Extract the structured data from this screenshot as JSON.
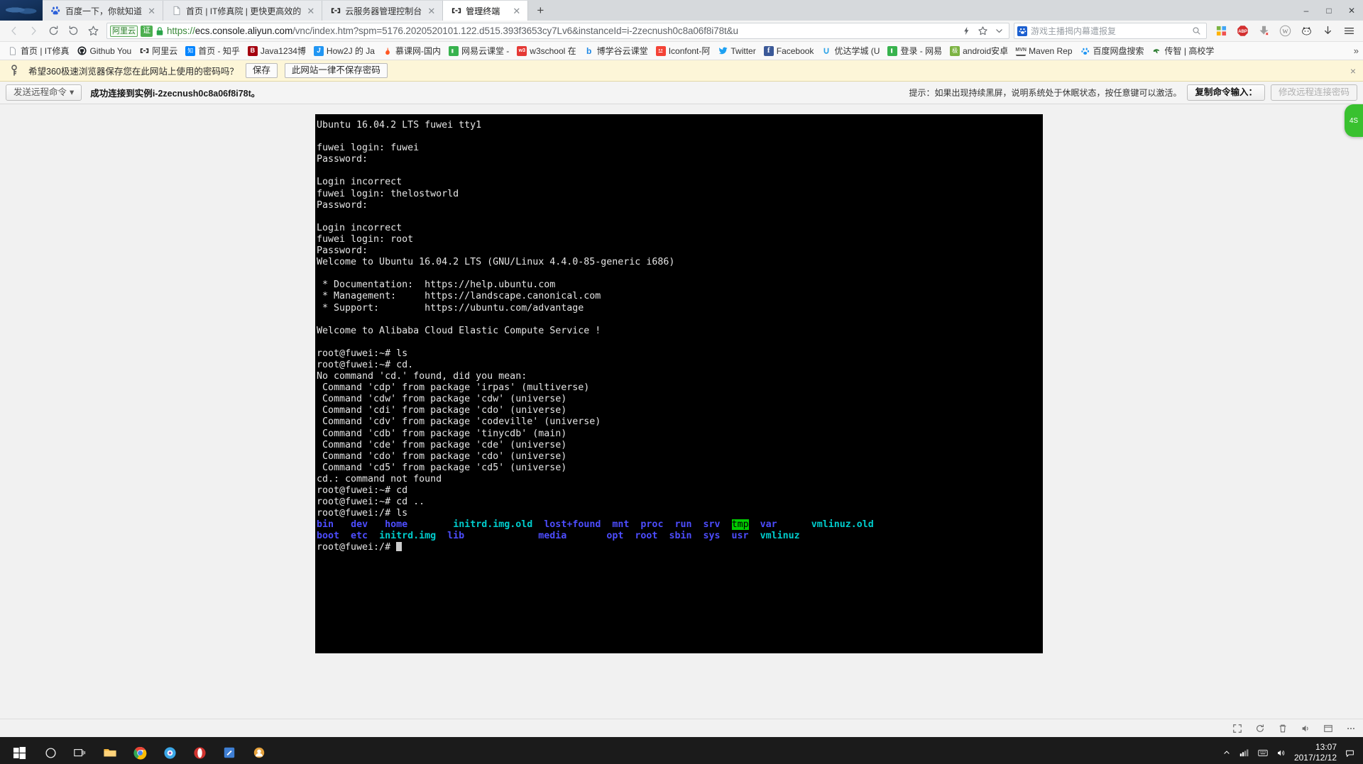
{
  "window": {
    "controls": [
      "minimize",
      "maximize",
      "close"
    ]
  },
  "tabs": [
    {
      "title": "百度一下，你就知道",
      "favicon": "baidu-icon",
      "active": false,
      "closable": true
    },
    {
      "title": "首页 | IT修真院 | 更快更高效的",
      "favicon": "page-icon",
      "active": false,
      "closable": true
    },
    {
      "title": "云服务器管理控制台",
      "favicon": "aliyun-icon",
      "active": false,
      "closable": true
    },
    {
      "title": "管理终端",
      "favicon": "aliyun-icon",
      "active": true,
      "closable": true
    }
  ],
  "newtab_label": "+",
  "nav": {
    "back": "back-arrow",
    "forward": "forward-arrow",
    "reload": "reload-icon",
    "restore": "undo-icon",
    "favorite": "star-icon"
  },
  "omnibox": {
    "badge_aliyun": "阿里云",
    "badge_cert": "证",
    "lock": "lock-icon",
    "url_scheme": "https://",
    "url_host": "ecs.console.aliyun.com",
    "url_path": "/vnc/index.htm?spm=5176.2020520101.122.d515.393f3653cy7Lv6&instanceId=i-2zecnush0c8a06f8i78t&u",
    "lightning": "lightning-icon",
    "star": "star-outline-icon",
    "chevron": "chevron-down-icon"
  },
  "search": {
    "icon": "paw-icon",
    "value": "游戏主播揭内幕遭报复",
    "button": "search-icon"
  },
  "toolbar_icons": [
    {
      "name": "apps-grid-icon",
      "glyph": "grid"
    },
    {
      "name": "adblock-icon",
      "glyph": "ABP"
    },
    {
      "name": "download-icon",
      "glyph": "arrow-down"
    },
    {
      "name": "wikipedia-icon",
      "glyph": "W"
    },
    {
      "name": "cat-extension-icon",
      "glyph": "cat"
    },
    {
      "name": "downloads-tray-icon",
      "glyph": "down"
    },
    {
      "name": "menu-icon",
      "glyph": "hamburger"
    }
  ],
  "bookmarks": {
    "items": [
      {
        "label": "首页 | IT修真",
        "icon": "page-icon",
        "color": "#ffffff"
      },
      {
        "label": "Github  You",
        "icon": "github-icon",
        "color": "#1b1f23"
      },
      {
        "label": "阿里云",
        "icon": "aliyun-icon",
        "color": "#1a1a1a"
      },
      {
        "label": "首页 - 知乎",
        "icon": "zhihu-icon",
        "color": "#0084ff"
      },
      {
        "label": "Java1234博",
        "icon": "java1234-icon",
        "color": "#a4000f"
      },
      {
        "label": "How2J 的 Ja",
        "icon": "how2j-icon",
        "color": "#2196f3"
      },
      {
        "label": "慕课网-国内",
        "icon": "imooc-icon",
        "color": "#ff5722"
      },
      {
        "label": "网易云课堂 -",
        "icon": "163study-icon",
        "color": "#37b24d"
      },
      {
        "label": "w3school 在",
        "icon": "w3school-icon",
        "color": "#e53935"
      },
      {
        "label": "博学谷云课堂",
        "icon": "boxuegu-icon",
        "color": "#1e88e5"
      },
      {
        "label": "Iconfont-阿",
        "icon": "iconfont-icon",
        "color": "#f44336"
      },
      {
        "label": "Twitter",
        "icon": "twitter-icon",
        "color": "#1da1f2"
      },
      {
        "label": "Facebook",
        "icon": "facebook-icon",
        "color": "#3b5998"
      },
      {
        "label": "优达学城 (U",
        "icon": "udacity-icon",
        "color": "#2fa4e7"
      },
      {
        "label": "登录 - 网易",
        "icon": "netease-icon",
        "color": "#37b24d"
      },
      {
        "label": "android安卓",
        "icon": "android-icon",
        "color": "#7cb342"
      },
      {
        "label": "Maven Rep",
        "icon": "maven-icon",
        "color": "#555555"
      },
      {
        "label": "百度网盘搜索",
        "icon": "baidupan-icon",
        "color": "#2196f3"
      },
      {
        "label": "传智 | 高校学",
        "icon": "chuanzhi-icon",
        "color": "#2e7d32"
      }
    ],
    "overflow": "»"
  },
  "password_bar": {
    "icon": "key-icon",
    "message": "希望360极速浏览器保存您在此网站上使用的密码吗？",
    "save_label": "保存",
    "never_label": "此网站一律不保存密码",
    "close": "×"
  },
  "vnc_toolbar": {
    "send_command_label": "发送远程命令",
    "send_command_caret": "▾",
    "status_prefix": "成功连接到实例",
    "status_instance": "i-2zecnush0c8a06f8i78t。",
    "hint": "提示：如果出现持续黑屏，说明系统处于休眠状态，按任意键可以激活。",
    "copy_input_label": "复制命令输入：",
    "change_password_label": "修改远程连接密码",
    "helper_badge": "4S"
  },
  "terminal": {
    "lines": [
      {
        "segments": [
          {
            "t": "Ubuntu 16.04.2 LTS fuwei tty1",
            "c": "c-white"
          }
        ]
      },
      {
        "segments": [
          {
            "t": "",
            "c": "c-white"
          }
        ]
      },
      {
        "segments": [
          {
            "t": "fuwei login: fuwei",
            "c": "c-white"
          }
        ]
      },
      {
        "segments": [
          {
            "t": "Password:",
            "c": "c-white"
          }
        ]
      },
      {
        "segments": [
          {
            "t": "",
            "c": "c-white"
          }
        ]
      },
      {
        "segments": [
          {
            "t": "Login incorrect",
            "c": "c-white"
          }
        ]
      },
      {
        "segments": [
          {
            "t": "fuwei login: thelostworld",
            "c": "c-white"
          }
        ]
      },
      {
        "segments": [
          {
            "t": "Password:",
            "c": "c-white"
          }
        ]
      },
      {
        "segments": [
          {
            "t": "",
            "c": "c-white"
          }
        ]
      },
      {
        "segments": [
          {
            "t": "Login incorrect",
            "c": "c-white"
          }
        ]
      },
      {
        "segments": [
          {
            "t": "fuwei login: root",
            "c": "c-white"
          }
        ]
      },
      {
        "segments": [
          {
            "t": "Password:",
            "c": "c-white"
          }
        ]
      },
      {
        "segments": [
          {
            "t": "Welcome to Ubuntu 16.04.2 LTS (GNU/Linux 4.4.0-85-generic i686)",
            "c": "c-white"
          }
        ]
      },
      {
        "segments": [
          {
            "t": "",
            "c": "c-white"
          }
        ]
      },
      {
        "segments": [
          {
            "t": " * Documentation:  https://help.ubuntu.com",
            "c": "c-white"
          }
        ]
      },
      {
        "segments": [
          {
            "t": " * Management:     https://landscape.canonical.com",
            "c": "c-white"
          }
        ]
      },
      {
        "segments": [
          {
            "t": " * Support:        https://ubuntu.com/advantage",
            "c": "c-white"
          }
        ]
      },
      {
        "segments": [
          {
            "t": "",
            "c": "c-white"
          }
        ]
      },
      {
        "segments": [
          {
            "t": "Welcome to Alibaba Cloud Elastic Compute Service !",
            "c": "c-white"
          }
        ]
      },
      {
        "segments": [
          {
            "t": "",
            "c": "c-white"
          }
        ]
      },
      {
        "segments": [
          {
            "t": "root@fuwei:~# ls",
            "c": "c-white"
          }
        ]
      },
      {
        "segments": [
          {
            "t": "root@fuwei:~# cd.",
            "c": "c-white"
          }
        ]
      },
      {
        "segments": [
          {
            "t": "No command 'cd.' found, did you mean:",
            "c": "c-white"
          }
        ]
      },
      {
        "segments": [
          {
            "t": " Command 'cdp' from package 'irpas' (multiverse)",
            "c": "c-white"
          }
        ]
      },
      {
        "segments": [
          {
            "t": " Command 'cdw' from package 'cdw' (universe)",
            "c": "c-white"
          }
        ]
      },
      {
        "segments": [
          {
            "t": " Command 'cdi' from package 'cdo' (universe)",
            "c": "c-white"
          }
        ]
      },
      {
        "segments": [
          {
            "t": " Command 'cdv' from package 'codeville' (universe)",
            "c": "c-white"
          }
        ]
      },
      {
        "segments": [
          {
            "t": " Command 'cdb' from package 'tinycdb' (main)",
            "c": "c-white"
          }
        ]
      },
      {
        "segments": [
          {
            "t": " Command 'cde' from package 'cde' (universe)",
            "c": "c-white"
          }
        ]
      },
      {
        "segments": [
          {
            "t": " Command 'cdo' from package 'cdo' (universe)",
            "c": "c-white"
          }
        ]
      },
      {
        "segments": [
          {
            "t": " Command 'cd5' from package 'cd5' (universe)",
            "c": "c-white"
          }
        ]
      },
      {
        "segments": [
          {
            "t": "cd.: command not found",
            "c": "c-white"
          }
        ]
      },
      {
        "segments": [
          {
            "t": "root@fuwei:~# cd",
            "c": "c-white"
          }
        ]
      },
      {
        "segments": [
          {
            "t": "root@fuwei:~# cd ..",
            "c": "c-white"
          }
        ]
      },
      {
        "segments": [
          {
            "t": "root@fuwei:/# ls",
            "c": "c-white"
          }
        ]
      },
      {
        "segments": [
          {
            "t": "bin",
            "c": "c-blue"
          },
          {
            "t": "   ",
            "c": "c-white"
          },
          {
            "t": "dev",
            "c": "c-blue"
          },
          {
            "t": "   ",
            "c": "c-white"
          },
          {
            "t": "home",
            "c": "c-blue"
          },
          {
            "t": "        ",
            "c": "c-white"
          },
          {
            "t": "initrd.img.old",
            "c": "c-cyan"
          },
          {
            "t": "  ",
            "c": "c-white"
          },
          {
            "t": "lost+found",
            "c": "c-blue"
          },
          {
            "t": "  ",
            "c": "c-white"
          },
          {
            "t": "mnt",
            "c": "c-blue"
          },
          {
            "t": "  ",
            "c": "c-white"
          },
          {
            "t": "proc",
            "c": "c-blue"
          },
          {
            "t": "  ",
            "c": "c-white"
          },
          {
            "t": "run",
            "c": "c-blue"
          },
          {
            "t": "  ",
            "c": "c-white"
          },
          {
            "t": "srv",
            "c": "c-blue"
          },
          {
            "t": "  ",
            "c": "c-white"
          },
          {
            "t": "tmp",
            "c": "c-tmp"
          },
          {
            "t": "  ",
            "c": "c-white"
          },
          {
            "t": "var",
            "c": "c-blue"
          },
          {
            "t": "      ",
            "c": "c-white"
          },
          {
            "t": "vmlinuz.old",
            "c": "c-cyan"
          }
        ]
      },
      {
        "segments": [
          {
            "t": "boot",
            "c": "c-blue"
          },
          {
            "t": "  ",
            "c": "c-white"
          },
          {
            "t": "etc",
            "c": "c-blue"
          },
          {
            "t": "  ",
            "c": "c-white"
          },
          {
            "t": "initrd.img",
            "c": "c-cyan"
          },
          {
            "t": "  ",
            "c": "c-white"
          },
          {
            "t": "lib",
            "c": "c-blue"
          },
          {
            "t": "             ",
            "c": "c-white"
          },
          {
            "t": "media",
            "c": "c-blue"
          },
          {
            "t": "       ",
            "c": "c-white"
          },
          {
            "t": "opt",
            "c": "c-blue"
          },
          {
            "t": "  ",
            "c": "c-white"
          },
          {
            "t": "root",
            "c": "c-blue"
          },
          {
            "t": "  ",
            "c": "c-white"
          },
          {
            "t": "sbin",
            "c": "c-blue"
          },
          {
            "t": "  ",
            "c": "c-white"
          },
          {
            "t": "sys",
            "c": "c-blue"
          },
          {
            "t": "  ",
            "c": "c-white"
          },
          {
            "t": "usr",
            "c": "c-blue"
          },
          {
            "t": "  ",
            "c": "c-white"
          },
          {
            "t": "vmlinuz",
            "c": "c-cyan"
          }
        ]
      },
      {
        "segments": [
          {
            "t": "root@fuwei:/# ",
            "c": "c-white"
          },
          {
            "t": "",
            "c": "cursor"
          }
        ]
      }
    ]
  },
  "bottom_strip": {
    "icons": [
      "expand-icon",
      "refresh-icon",
      "trash-icon",
      "volume-icon",
      "window-icon",
      "more-icon"
    ]
  },
  "taskbar": {
    "start": "windows-start-icon",
    "items": [
      {
        "name": "cortana-icon"
      },
      {
        "name": "task-view-icon"
      },
      {
        "name": "file-explorer-icon"
      },
      {
        "name": "chrome-icon"
      },
      {
        "name": "360-browser-icon"
      },
      {
        "name": "opera-icon"
      },
      {
        "name": "editor-icon"
      },
      {
        "name": "app-icon"
      }
    ],
    "tray": [
      "chevron-up-icon",
      "network-icon",
      "input-icon",
      "volume-icon"
    ],
    "time": "13:07",
    "date": "2017/12/12",
    "notification": "notification-icon"
  },
  "colors": {
    "accent_green": "#39c12f",
    "terminal_bg": "#000000",
    "terminal_blue": "#4d4dff",
    "terminal_cyan": "#00cdcd",
    "terminal_tmp_bg": "#00cd00",
    "password_bar_bg": "#fdf6d8"
  }
}
